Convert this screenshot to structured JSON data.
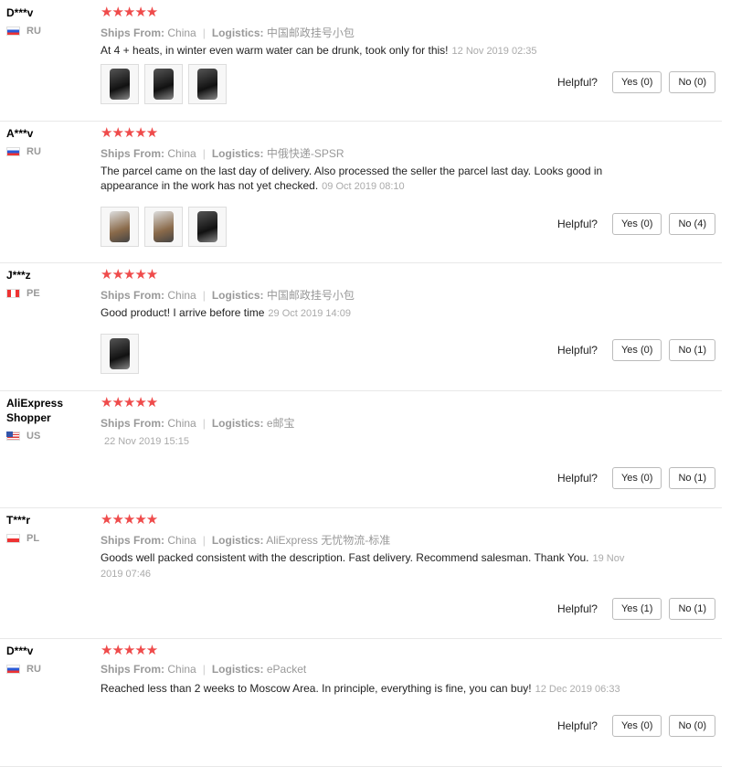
{
  "labels": {
    "ships_from": "Ships From:",
    "logistics": "Logistics:",
    "helpful": "Helpful?"
  },
  "colors": {
    "star": "#ef4b4b",
    "muted": "#999999"
  },
  "reviews": [
    {
      "user": "D***v",
      "country": "RU",
      "flag": "flag-ru",
      "stars": "★★★★★",
      "ships_from": "China",
      "logistics": "中国邮政挂号小包",
      "text": "At 4 + heats, in winter even warm water can be drunk, took only for this!",
      "date": "12 Nov 2019 02:35",
      "photos": 3,
      "yes": "Yes (0)",
      "no": "No (0)"
    },
    {
      "user": "A***v",
      "country": "RU",
      "flag": "flag-ru",
      "stars": "★★★★★",
      "ships_from": "China",
      "logistics": "中俄快递-SPSR",
      "text": "The parcel came on the last day of delivery. Also processed the seller the parcel last day. Looks good in appearance in the work has not yet checked.",
      "date": "09 Oct 2019 08:10",
      "photos": 3,
      "yes": "Yes (0)",
      "no": "No (4)"
    },
    {
      "user": "J***z",
      "country": "PE",
      "flag": "flag-pe",
      "stars": "★★★★★",
      "ships_from": "China",
      "logistics": "中国邮政挂号小包",
      "text": "Good product! I arrive before time",
      "date": "29 Oct 2019 14:09",
      "photos": 1,
      "yes": "Yes (0)",
      "no": "No (1)"
    },
    {
      "user": "AliExpress Shopper",
      "country": "US",
      "flag": "flag-us",
      "stars": "★★★★★",
      "ships_from": "China",
      "logistics": "e邮宝",
      "text": "",
      "date": "22 Nov 2019 15:15",
      "photos": 0,
      "yes": "Yes (0)",
      "no": "No (1)"
    },
    {
      "user": "T***r",
      "country": "PL",
      "flag": "flag-pl",
      "stars": "★★★★★",
      "ships_from": "China",
      "logistics": "AliExpress 无忧物流-标准",
      "text": "Goods well packed consistent with the description. Fast delivery. Recommend salesman. Thank You.",
      "date": "19 Nov 2019 07:46",
      "photos": 0,
      "yes": "Yes (1)",
      "no": "No (1)"
    },
    {
      "user": "D***v",
      "country": "RU",
      "flag": "flag-ru",
      "stars": "★★★★★",
      "ships_from": "China",
      "logistics": "ePacket",
      "text": "Reached less than 2 weeks to Moscow Area. In principle, everything is fine, you can buy!",
      "date": "12 Dec 2019 06:33",
      "photos": 0,
      "yes": "Yes (0)",
      "no": "No (0)"
    }
  ]
}
